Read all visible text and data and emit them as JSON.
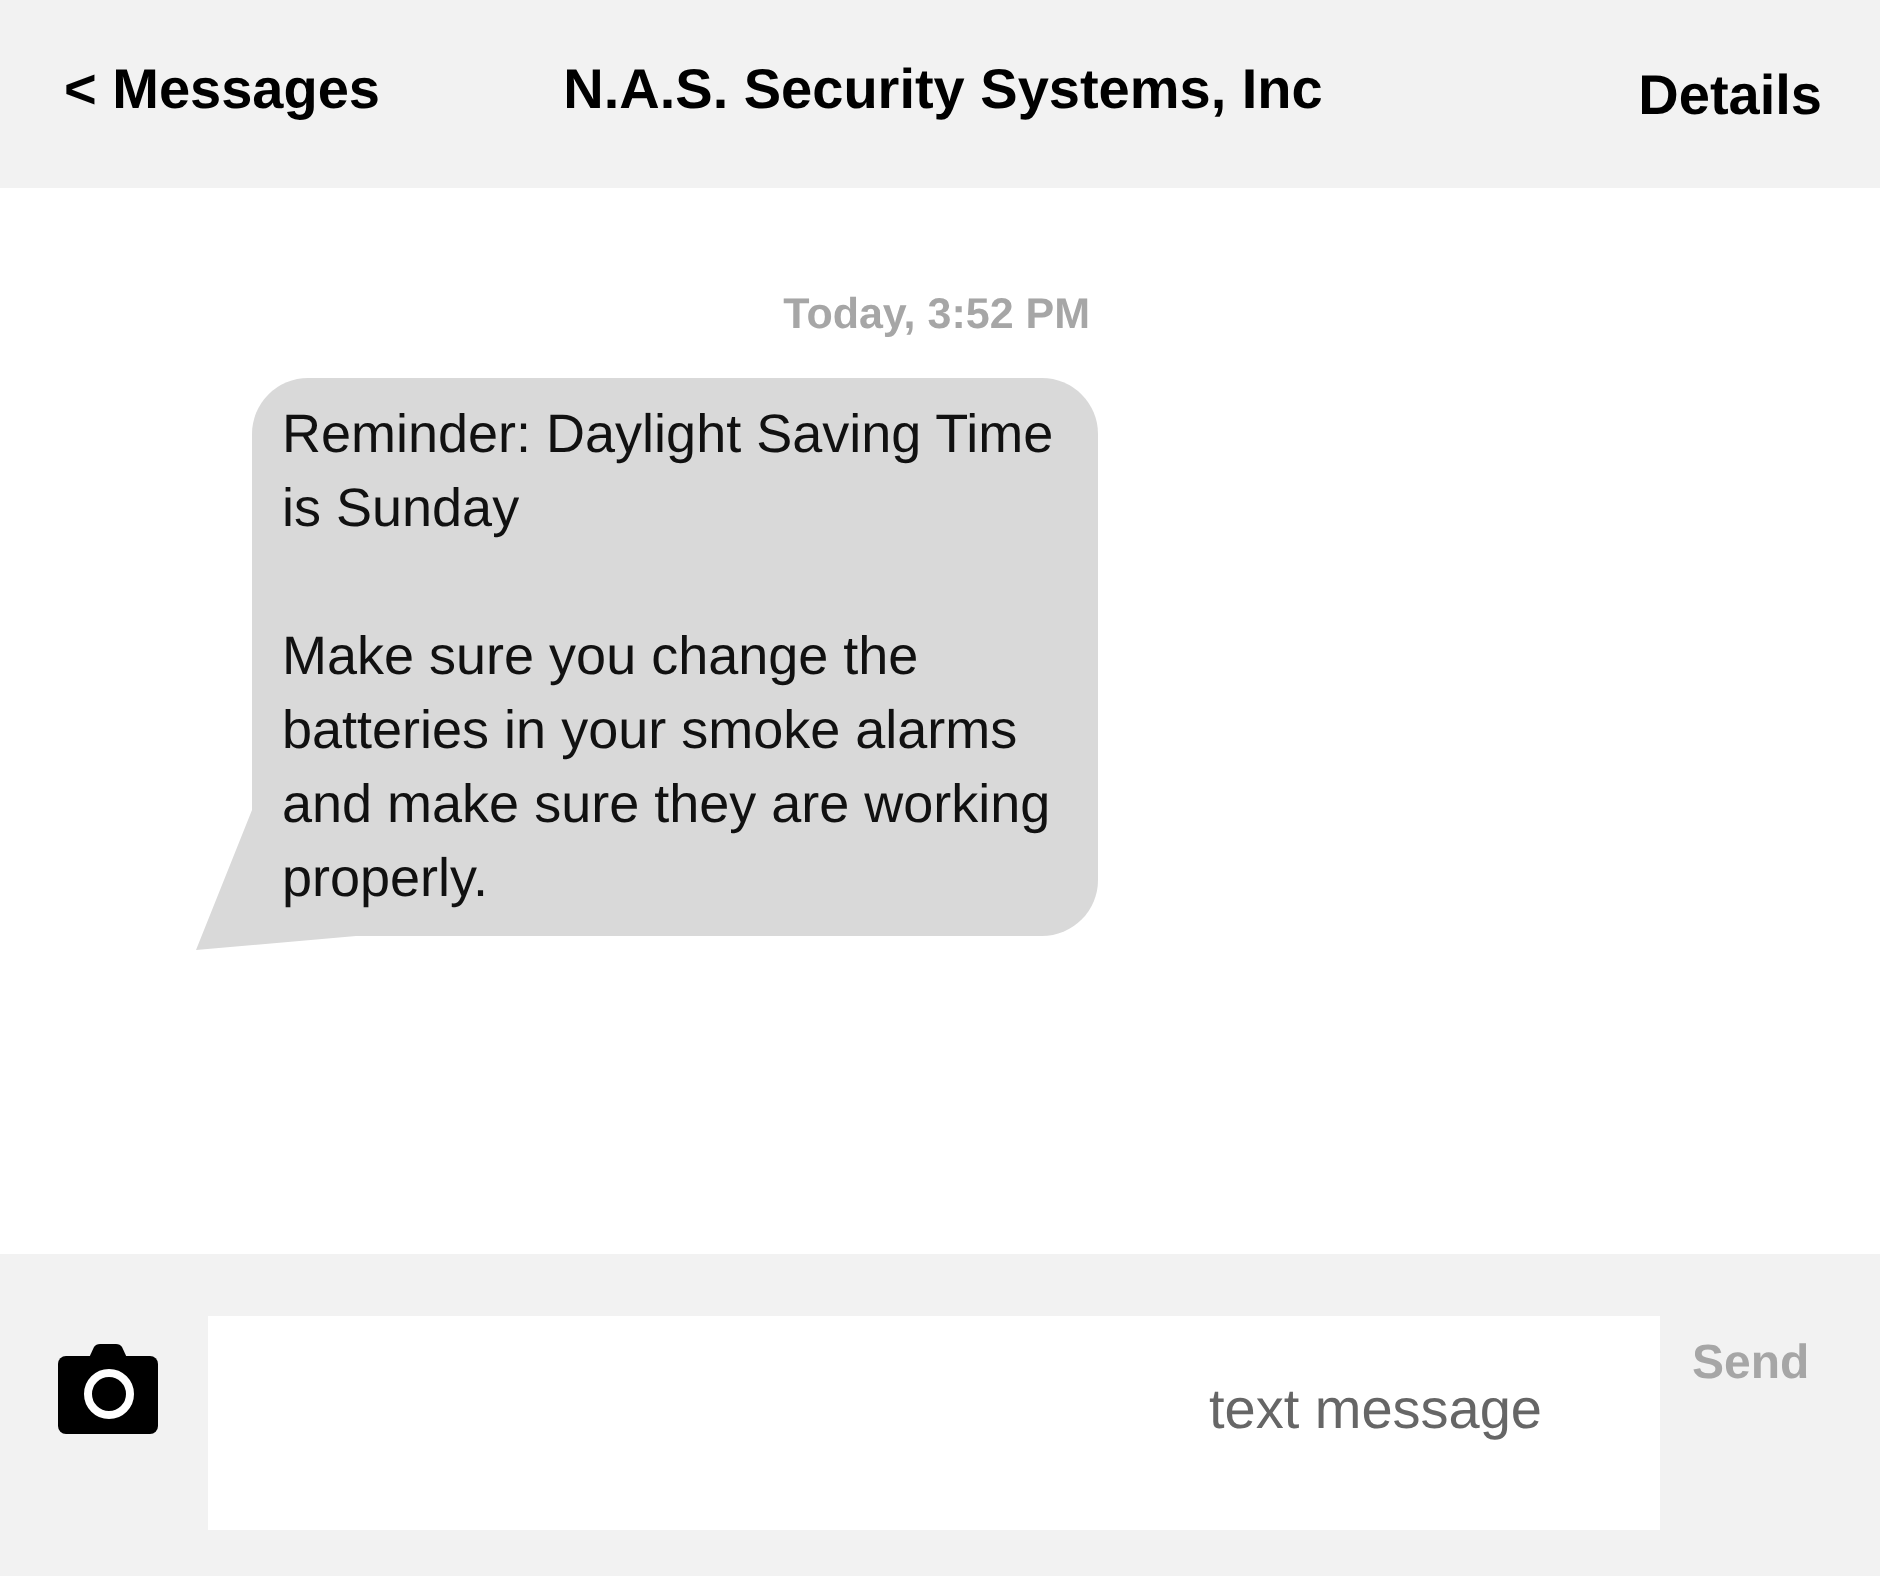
{
  "header": {
    "back_button": "< Messages",
    "title": "N.A.S. Security Systems, Inc",
    "details_button": "Details"
  },
  "conversation": {
    "timestamp": "Today, 3:52 PM",
    "messages": [
      {
        "paragraphs": [
          "Reminder: Daylight Saving Time is Sunday",
          "Make sure you change the batteries in your smoke alarms and make sure they are working properly."
        ]
      }
    ]
  },
  "composer": {
    "placeholder": "text message",
    "send_button": {
      "label": "Send",
      "disabled": true
    }
  }
}
